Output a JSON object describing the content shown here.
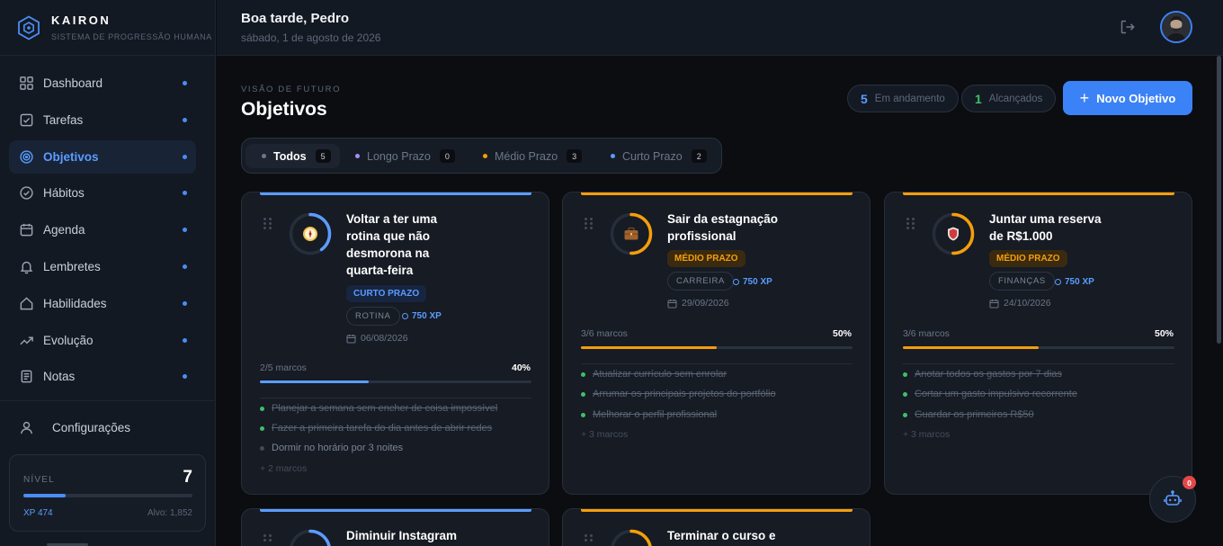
{
  "brand": {
    "name": "KAIRON",
    "subtitle": "SISTEMA DE PROGRESSÃO HUMANA"
  },
  "sidebar": {
    "items": [
      {
        "label": "Dashboard",
        "icon": "grid-icon"
      },
      {
        "label": "Tarefas",
        "icon": "checkbox-icon"
      },
      {
        "label": "Objetivos",
        "icon": "target-icon",
        "active": true
      },
      {
        "label": "Hábitos",
        "icon": "check-circle-icon"
      },
      {
        "label": "Agenda",
        "icon": "calendar-icon"
      },
      {
        "label": "Lembretes",
        "icon": "bell-icon"
      },
      {
        "label": "Habilidades",
        "icon": "home-icon"
      },
      {
        "label": "Evolução",
        "icon": "trend-icon"
      },
      {
        "label": "Notas",
        "icon": "note-icon"
      }
    ],
    "settings_label": "Configurações",
    "level": {
      "label": "NÍVEL",
      "value": "7",
      "progress": 0.25,
      "xp": "XP 474",
      "target": "Alvo: 1,852"
    }
  },
  "header": {
    "greeting": "Boa tarde, Pedro",
    "date": "sábado, 1 de agosto de 2026"
  },
  "main": {
    "eyebrow": "VISÃO DE FUTURO",
    "title": "Objetivos",
    "stats": [
      {
        "value": "5",
        "label": "Em andamento",
        "color": "#5b9cff"
      },
      {
        "value": "1",
        "label": "Alcançados",
        "color": "#3fbf6a"
      }
    ],
    "new_button": "Novo Objetivo",
    "filters": [
      {
        "label": "Todos",
        "count": "5",
        "dot": "#6c7788",
        "active": true
      },
      {
        "label": "Longo Prazo",
        "count": "0",
        "dot": "#a78bfa"
      },
      {
        "label": "Médio Prazo",
        "count": "3",
        "dot": "#f59e0b"
      },
      {
        "label": "Curto Prazo",
        "count": "2",
        "dot": "#5b9cff"
      }
    ],
    "cards": [
      {
        "title": "Voltar a ter uma rotina que não desmorona na quarta-feira",
        "term": "CURTO PRAZO",
        "term_color": "#5b9cff",
        "term_bg": "#172540",
        "accent": "#5b9cff",
        "category": "ROTINA",
        "xp": "750 XP",
        "date": "06/08/2026",
        "icon": "compass-icon",
        "milestones_label": "2/5 marcos",
        "percent": "40%",
        "progress": 0.4,
        "milestones": [
          {
            "text": "Planejar a semana sem encher de coisa impossível",
            "done": true
          },
          {
            "text": "Fazer a primeira tarefa do dia antes de abrir redes",
            "done": true
          },
          {
            "text": "Dormir no horário por 3 noites",
            "done": false
          }
        ],
        "more": "+ 2 marcos"
      },
      {
        "title": "Sair da estagnação profissional",
        "term": "MÉDIO PRAZO",
        "term_color": "#f59e0b",
        "term_bg": "#3a2a0f",
        "accent": "#f59e0b",
        "category": "CARREIRA",
        "xp": "750 XP",
        "date": "29/09/2026",
        "icon": "briefcase-icon",
        "milestones_label": "3/6 marcos",
        "percent": "50%",
        "progress": 0.5,
        "milestones": [
          {
            "text": "Atualizar currículo sem enrolar",
            "done": true
          },
          {
            "text": "Arrumar os principais projetos do portfólio",
            "done": true
          },
          {
            "text": "Melhorar o perfil profissional",
            "done": true
          }
        ],
        "more": "+ 3 marcos"
      },
      {
        "title": "Juntar uma reserva de R$1.000",
        "term": "MÉDIO PRAZO",
        "term_color": "#f59e0b",
        "term_bg": "#3a2a0f",
        "accent": "#f59e0b",
        "category": "FINANÇAS",
        "xp": "750 XP",
        "date": "24/10/2026",
        "icon": "shield-icon",
        "milestones_label": "3/6 marcos",
        "percent": "50%",
        "progress": 0.5,
        "milestones": [
          {
            "text": "Anotar todos os gastos por 7 dias",
            "done": true
          },
          {
            "text": "Cortar um gasto impulsivo recorrente",
            "done": true
          },
          {
            "text": "Guardar os primeiros R$50",
            "done": true
          }
        ],
        "more": "+ 3 marcos"
      },
      {
        "title": "Diminuir Instagram",
        "accent": "#5b9cff",
        "progress": 0.4
      },
      {
        "title": "Terminar o curso e",
        "accent": "#f59e0b",
        "progress": 0.5
      }
    ]
  },
  "fab": {
    "icon": "robot-icon",
    "badge": "0"
  }
}
